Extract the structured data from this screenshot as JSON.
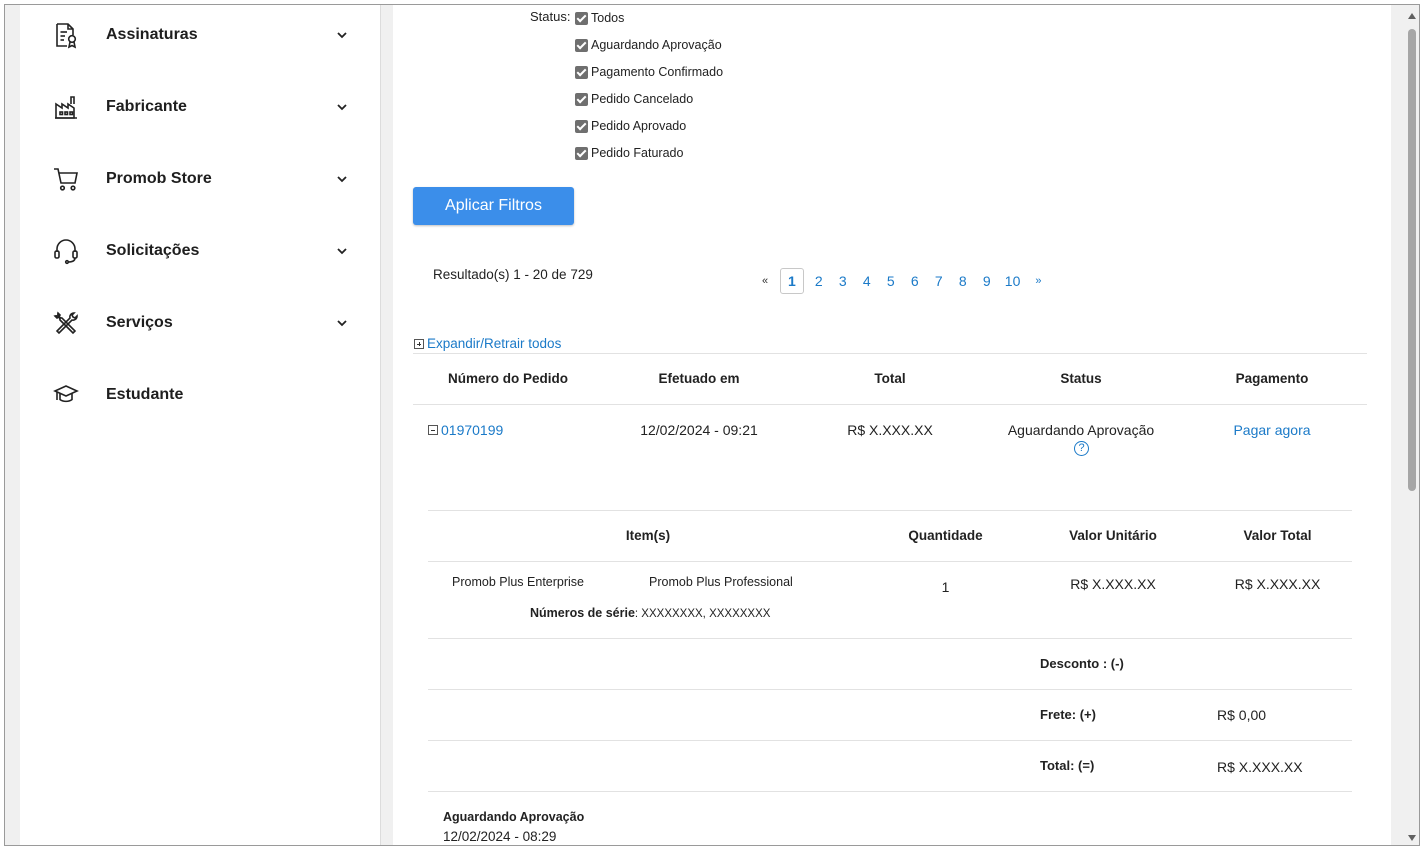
{
  "sidebar": {
    "items": [
      {
        "label": "Assinaturas",
        "icon": "document-certificate-icon",
        "has_chevron": true
      },
      {
        "label": "Fabricante",
        "icon": "factory-icon",
        "has_chevron": true
      },
      {
        "label": "Promob Store",
        "icon": "shopping-cart-icon",
        "has_chevron": true
      },
      {
        "label": "Solicitações",
        "icon": "headset-icon",
        "has_chevron": true
      },
      {
        "label": "Serviços",
        "icon": "tools-icon",
        "has_chevron": true
      },
      {
        "label": "Estudante",
        "icon": "graduation-cap-icon",
        "has_chevron": false
      }
    ]
  },
  "filters": {
    "status_label": "Status:",
    "options": [
      {
        "label": "Todos",
        "checked": true
      },
      {
        "label": "Aguardando Aprovação",
        "checked": true
      },
      {
        "label": "Pagamento Confirmado",
        "checked": true
      },
      {
        "label": "Pedido Cancelado",
        "checked": true
      },
      {
        "label": "Pedido Aprovado",
        "checked": true
      },
      {
        "label": "Pedido Faturado",
        "checked": true
      }
    ],
    "apply_label": "Aplicar Filtros"
  },
  "results": {
    "summary": "Resultado(s) 1 - 20 de 729",
    "pagination": {
      "prev": "«",
      "next": "»",
      "pages": [
        "1",
        "2",
        "3",
        "4",
        "5",
        "6",
        "7",
        "8",
        "9",
        "10"
      ],
      "current": "1"
    }
  },
  "orders": {
    "expand_all_label": "Expandir/Retrair todos",
    "headers": [
      "Número do Pedido",
      "Efetuado em",
      "Total",
      "Status",
      "Pagamento"
    ],
    "row": {
      "number": "01970199",
      "date": "12/02/2024 - 09:21",
      "total": "R$ X.XXX.XX",
      "status": "Aguardando Aprovação",
      "payment_link": "Pagar agora"
    },
    "details": {
      "headers": [
        "Item(s)",
        "Quantidade",
        "Valor Unitário",
        "Valor Total"
      ],
      "item_product": "Promob Plus Enterprise",
      "item_edition": "Promob Plus Professional",
      "quantity": "1",
      "unit_value": "R$ X.XXX.XX",
      "total_value": "R$ X.XXX.XX",
      "serial_label": "Números de série",
      "serial_values": ": XXXXXXXX, XXXXXXXX",
      "discount_label": "Desconto : (-)",
      "shipping_label": "Frete: (+)",
      "shipping_value": "R$ 0,00",
      "total_label": "Total: (=)",
      "total_value_summary": "R$ X.XXX.XX"
    },
    "history": {
      "status": "Aguardando Aprovação",
      "date": "12/02/2024 - 08:29"
    }
  }
}
